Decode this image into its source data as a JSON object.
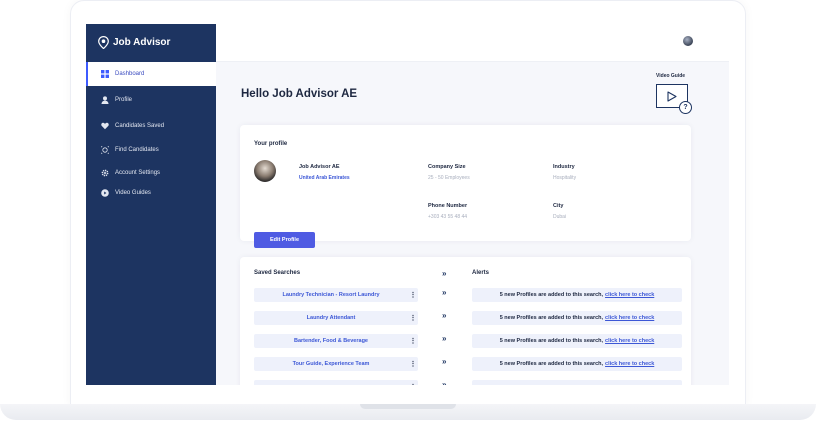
{
  "app": {
    "brand": "Job Advisor"
  },
  "sidebar": {
    "items": [
      {
        "label": "Dashboard",
        "icon": "dashboard-icon",
        "active": true
      },
      {
        "label": "Profile",
        "icon": "user-icon"
      },
      {
        "label": "Candidates Saved",
        "icon": "heart-icon"
      },
      {
        "label": "Find Candidates",
        "icon": "target-icon"
      },
      {
        "label": "Account Settings",
        "icon": "gear-icon"
      },
      {
        "label": "Video Guides",
        "icon": "play-circle-icon"
      }
    ]
  },
  "header": {
    "greeting": "Hello Job Advisor AE"
  },
  "video_guide": {
    "label": "Video Guide",
    "help": "?"
  },
  "profile": {
    "title": "Your profile",
    "name": "Job Advisor AE",
    "location": "United Arab Emirates",
    "company_size_label": "Company Size",
    "company_size": "25 - 50 Employees",
    "industry_label": "Industry",
    "industry": "Hospitality",
    "phone_label": "Phone Number",
    "phone": "+303 43 55 48 44",
    "city_label": "City",
    "city": "Dubai",
    "edit_label": "Edit Profile"
  },
  "searches": {
    "saved_title": "Saved Searches",
    "alerts_title": "Alerts",
    "arrow": "»",
    "kebab": "⋮",
    "rows": [
      {
        "name": "Laundry Technician - Resort Laundry",
        "alert": "5 new Profiles are added to this search,",
        "link": "click here to check"
      },
      {
        "name": "Laundry Attendant",
        "alert": "5 new Profiles are added to this search,",
        "link": "click here to check"
      },
      {
        "name": "Bartender, Food & Beverage",
        "alert": "5 new Profiles are added to this search,",
        "link": "click here to check"
      },
      {
        "name": "Tour Guide, Experience Team",
        "alert": "5 new Profiles are added to this search,",
        "link": "click here to check"
      },
      {
        "name": "",
        "alert": "",
        "link": ""
      }
    ]
  },
  "colors": {
    "sidebar": "#1d3461",
    "accent": "#4f5be3",
    "link": "#3c57d6"
  }
}
